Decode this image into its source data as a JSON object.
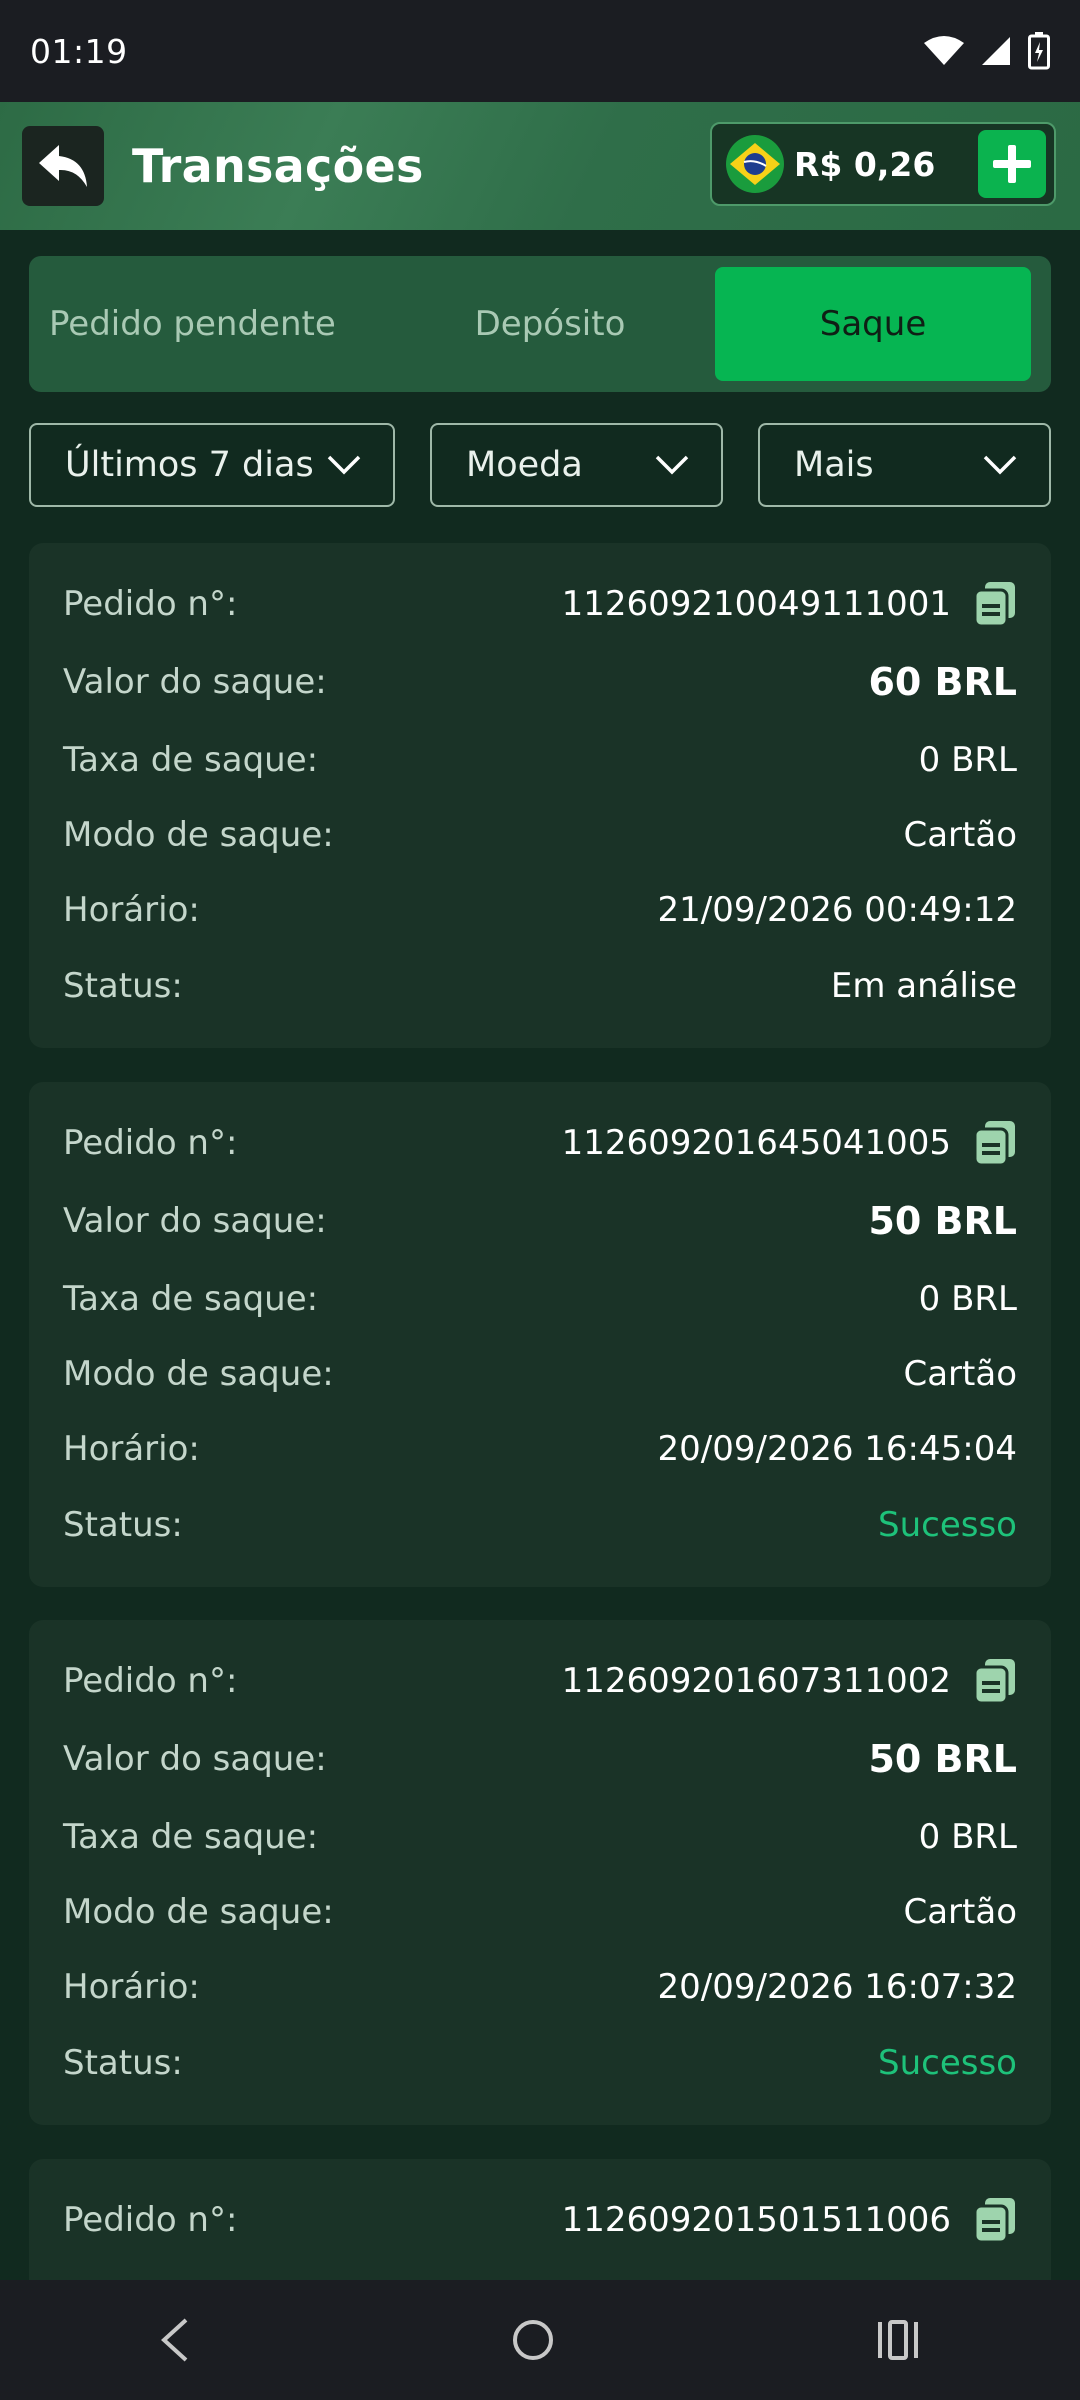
{
  "status_bar": {
    "time": "01:19"
  },
  "header": {
    "title": "Transações",
    "balance": "R$ 0,26"
  },
  "tabs": [
    {
      "label": "Pedido pendente"
    },
    {
      "label": "Depósito"
    },
    {
      "label": "Saque"
    }
  ],
  "filters": [
    {
      "label": "Últimos 7 dias"
    },
    {
      "label": "Moeda"
    },
    {
      "label": "Mais"
    }
  ],
  "labels": {
    "order": "Pedido n°:",
    "amount": "Valor do saque:",
    "fee": "Taxa de saque:",
    "mode": "Modo de saque:",
    "time": "Horário:",
    "status": "Status:"
  },
  "transactions": [
    {
      "order": "112609210049111001",
      "amount": "60 BRL",
      "fee": "0 BRL",
      "mode": "Cartão",
      "time": "21/09/2026 00:49:12",
      "status": "Em análise"
    },
    {
      "order": "112609201645041005",
      "amount": "50 BRL",
      "fee": "0 BRL",
      "mode": "Cartão",
      "time": "20/09/2026 16:45:04",
      "status": "Sucesso"
    },
    {
      "order": "112609201607311002",
      "amount": "50 BRL",
      "fee": "0 BRL",
      "mode": "Cartão",
      "time": "20/09/2026 16:07:32",
      "status": "Sucesso"
    },
    {
      "order": "112609201501511006"
    }
  ],
  "colors": {
    "accent": "#06b552",
    "success": "#1ec27a",
    "card_bg": "#1a3327",
    "page_bg": "#112a1f"
  },
  "icons": [
    "back-arrow-icon",
    "brazil-flag-icon",
    "plus-icon",
    "chevron-down-icon",
    "copy-icon",
    "nav-back-icon",
    "nav-home-icon",
    "nav-recents-icon",
    "wifi-icon",
    "signal-icon",
    "battery-icon"
  ]
}
